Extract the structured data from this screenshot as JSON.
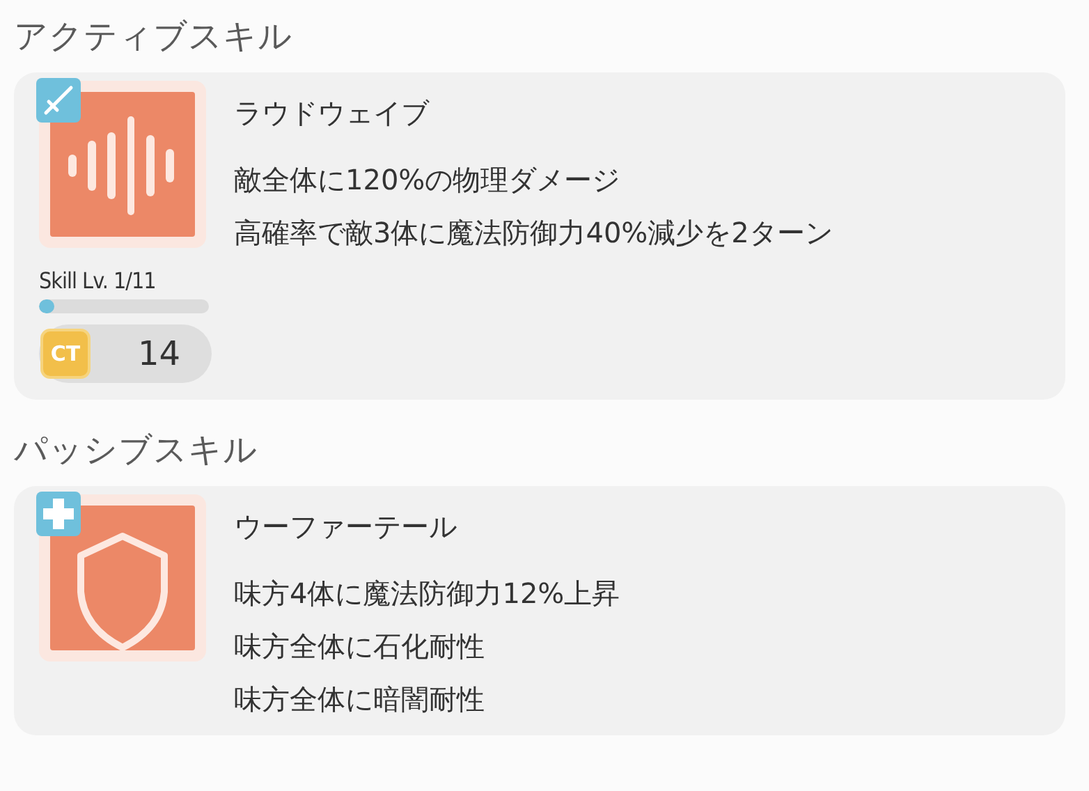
{
  "sections": [
    {
      "heading": "アクティブスキル",
      "skill": {
        "kind": "active",
        "name": "ラウドウェイブ",
        "level_label": "Skill Lv. 1/11",
        "level": 0.09,
        "ct_label": "CT",
        "ct": "14",
        "lines": [
          "敵全体に120%の物理ダメージ",
          "高確率で敵3体に魔法防御力40%減少を2ターン"
        ]
      }
    },
    {
      "heading": "パッシブスキル",
      "skill": {
        "kind": "passive",
        "name": "ウーファーテール",
        "lines": [
          "味方4体に魔法防御力12%上昇",
          "味方全体に石化耐性",
          "味方全体に暗闇耐性"
        ]
      }
    }
  ]
}
